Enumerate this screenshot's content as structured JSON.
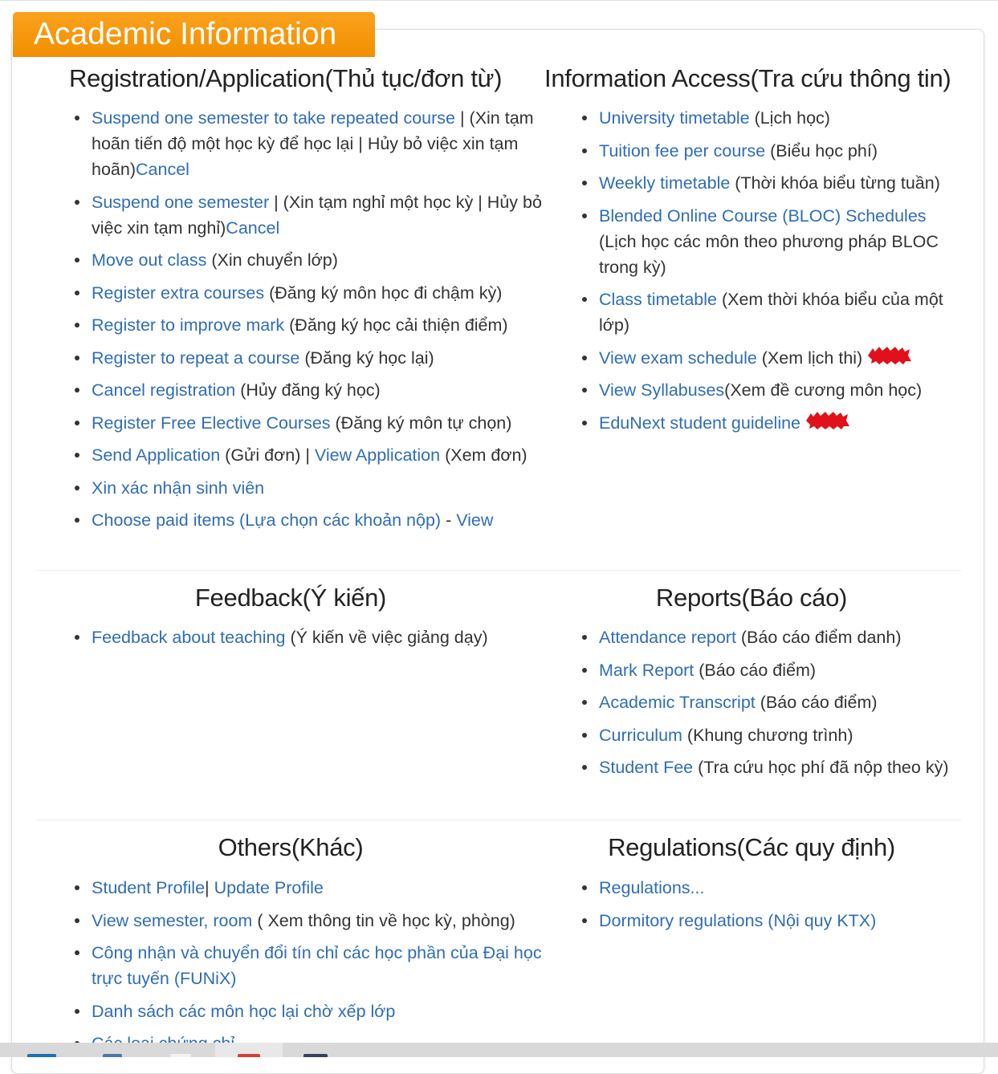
{
  "heading": "Academic Information",
  "sections": {
    "registration": {
      "title": "Registration/Application(Thủ tục/đơn từ)",
      "items": [
        {
          "link": "Suspend one semester to take repeated course",
          "sep": " | ",
          "link2": "Cancel",
          "text": " (Xin tạm hoãn tiến độ một học kỳ để học lại | Hủy bỏ việc xin tạm hoãn)"
        },
        {
          "link": "Suspend one semester",
          "sep": " |  ",
          "link2": "Cancel",
          "text": " (Xin tạm nghỉ một học kỳ | Hủy bỏ việc xin tạm nghỉ)"
        },
        {
          "link": "Move out class",
          "text": " (Xin chuyển lớp)"
        },
        {
          "link": "Register extra courses",
          "text": " (Đăng ký môn học đi chậm kỳ)"
        },
        {
          "link": "Register to improve mark",
          "text": "  (Đăng ký học cải thiện điểm)"
        },
        {
          "link": "Register to repeat a course",
          "text": " (Đăng ký học lại)"
        },
        {
          "link": "Cancel registration",
          "text": " (Hủy đăng ký học)"
        },
        {
          "link": "Register Free Elective Courses",
          "text": " (Đăng ký môn tự chọn)"
        },
        {
          "link": "Send Application",
          "text": " (Gửi đơn) |  ",
          "link2": "View Application",
          "text2": " (Xem đơn)"
        },
        {
          "link": "Xin xác nhận sinh viên"
        },
        {
          "link": "Choose paid items (Lựa chọn các khoản nộp)",
          "sep": " - ",
          "link2": "View"
        }
      ]
    },
    "information": {
      "title": "Information Access(Tra cứu thông tin)",
      "items": [
        {
          "link": "University timetable",
          "text": " (Lịch học)"
        },
        {
          "link": "Tuition fee per course",
          "text": " (Biểu học phí)"
        },
        {
          "link": "Weekly timetable",
          "text": " (Thời khóa biểu từng tuần)"
        },
        {
          "link": "Blended Online Course (BLOC) Schedules",
          "text": " (Lịch học các môn theo phương pháp BLOC trong kỳ)"
        },
        {
          "link": "Class timetable",
          "text": " (Xem thời khóa biểu của một lớp)"
        },
        {
          "link": "View exam schedule",
          "text": " (Xem lịch thi)",
          "badge": "NEW"
        },
        {
          "link": "View Syllabuses",
          "text": "(Xem đề cương môn học)"
        },
        {
          "link": "EduNext student guideline",
          "badge": "NEW"
        }
      ]
    },
    "feedback": {
      "title": "Feedback(Ý kiến)",
      "items": [
        {
          "link": "Feedback about teaching",
          "text": " (Ý kiến về việc giảng dạy)"
        }
      ]
    },
    "reports": {
      "title": "Reports(Báo cáo)",
      "items": [
        {
          "link": "Attendance report",
          "text": " (Báo cáo điểm danh)"
        },
        {
          "link": "Mark Report",
          "text": " (Báo cáo điểm)"
        },
        {
          "link": "Academic Transcript",
          "text": " (Báo cáo điểm)"
        },
        {
          "link": "Curriculum",
          "text": " (Khung chương trình)"
        },
        {
          "link": "Student Fee",
          "text": " (Tra cứu học phí đã nộp theo kỳ)"
        }
      ]
    },
    "others": {
      "title": "Others(Khác)",
      "items": [
        {
          "link": "Student Profile",
          "sep": "| ",
          "link2": "Update Profile"
        },
        {
          "link": "View semester, room",
          "text": " ( Xem thông tin về học kỳ, phòng)"
        },
        {
          "link": "Công nhận và chuyển đổi tín chỉ các học phần của Đại học trực tuyến (FUNiX)"
        },
        {
          "link": "Danh sách các môn học lại chờ xếp lớp"
        },
        {
          "link": "Các loại chứng chỉ"
        }
      ]
    },
    "regulations": {
      "title": "Regulations(Các quy định)",
      "items": [
        {
          "link": "Regulations..."
        },
        {
          "link": "Dormitory regulations (Nội quy KTX)"
        }
      ]
    }
  },
  "colors": {
    "accent": "#f39200",
    "link": "#2f6db5",
    "text": "#333333",
    "badge": "#e0111b"
  },
  "icons": [
    "new-badge-icon",
    "taskbar-app-icons"
  ]
}
